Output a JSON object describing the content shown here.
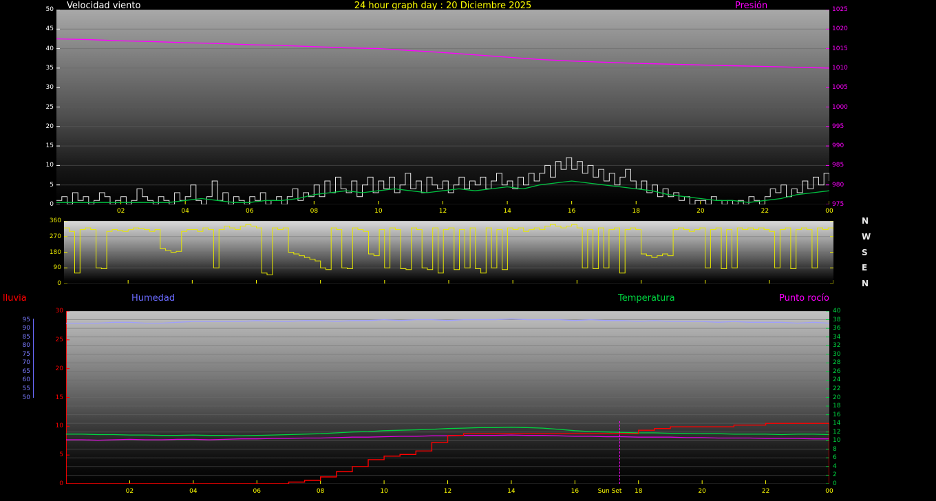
{
  "header": {
    "wind_speed": "Velocidad viento",
    "title": "24 hour graph day : 20 Diciembre 2025",
    "pressure": "Presión"
  },
  "bottom_labels": {
    "rain": "lluvia",
    "humidity": "Humedad",
    "temperature": "Temperatura",
    "dew_point": "Punto rocío"
  },
  "sun_set_label": "Sun Set",
  "x_ticks": [
    "02",
    "04",
    "06",
    "08",
    "10",
    "12",
    "14",
    "16",
    "18",
    "20",
    "22",
    "00"
  ],
  "compass": [
    "N",
    "W",
    "S",
    "E",
    "N"
  ],
  "colors": {
    "title": "#ffff00",
    "wind": "#e8e8e8",
    "wind_avg": "#00c040",
    "pressure": "#ff00ff",
    "direction": "#e8e800",
    "rain": "#ff0000",
    "humidity": "#7b7bff",
    "temperature": "#00d540",
    "dew_point": "#e000e0",
    "x_ticks": "#ffff00"
  },
  "axes": {
    "wind": {
      "min": 0,
      "max": 50,
      "ticks": [
        50,
        45,
        40,
        35,
        30,
        25,
        20,
        15,
        10,
        5,
        0
      ],
      "color": "#ffffff"
    },
    "pressure": {
      "min": 975,
      "max": 1025,
      "ticks": [
        1025,
        1020,
        1015,
        1010,
        1005,
        1000,
        995,
        990,
        985,
        980,
        975
      ],
      "color": "#ff00ff"
    },
    "direction": {
      "min": 0,
      "max": 360,
      "ticks": [
        360,
        270,
        180,
        90,
        0
      ],
      "color": "#e8e800"
    },
    "humidity": {
      "min": 0,
      "max": 100,
      "ticks": [
        95,
        90,
        85,
        80,
        75,
        70,
        65,
        60,
        55,
        50
      ],
      "color": "#7b7bff"
    },
    "rain": {
      "min": 0,
      "max": 30,
      "ticks": [
        30,
        25,
        20,
        15,
        10,
        5,
        0
      ],
      "color": "#ff0000"
    },
    "temperature": {
      "min": 0,
      "max": 40,
      "ticks": [
        40,
        38,
        36,
        34,
        32,
        30,
        28,
        26,
        24,
        22,
        20,
        18,
        16,
        14,
        12,
        10,
        8,
        6,
        4,
        2,
        0
      ],
      "color": "#00d540"
    }
  },
  "chart_data": [
    {
      "type": "line",
      "title": "Velocidad viento / Presión",
      "x_range": [
        0,
        24
      ],
      "grid_axis": "wind",
      "grid_color": "#636363",
      "x_tick_color": "#ffff00",
      "edge_ticks": [
        {
          "axis": "wind",
          "side": "left",
          "color": "#ffffff"
        },
        {
          "axis": "pressure",
          "side": "right",
          "color": "#ff00ff"
        }
      ],
      "series": [
        {
          "name": "pressure-hpa",
          "color": "#ff00ff",
          "axis": "pressure",
          "mode": "linear",
          "width": 1.4,
          "step_hours": 1,
          "values": [
            1017.5,
            1017.3,
            1017.0,
            1016.8,
            1016.5,
            1016.3,
            1016.0,
            1015.8,
            1015.5,
            1015.2,
            1015.0,
            1014.5,
            1014.0,
            1013.4,
            1012.8,
            1012.2,
            1011.8,
            1011.5,
            1011.2,
            1011.0,
            1010.8,
            1010.6,
            1010.4,
            1010.2,
            1010.0
          ]
        },
        {
          "name": "wind-gust",
          "color": "#e8e8e8",
          "axis": "wind",
          "mode": "step",
          "width": 1,
          "step_hours": 0.1666667,
          "values": [
            1,
            2,
            0,
            3,
            1,
            2,
            0,
            1,
            3,
            2,
            0,
            1,
            2,
            0,
            1,
            4,
            2,
            1,
            0,
            2,
            1,
            0,
            3,
            1,
            2,
            5,
            1,
            0,
            2,
            6,
            1,
            3,
            0,
            2,
            1,
            0,
            2,
            1,
            3,
            0,
            1,
            2,
            0,
            2,
            4,
            1,
            3,
            2,
            5,
            2,
            6,
            3,
            7,
            4,
            3,
            6,
            2,
            5,
            7,
            3,
            6,
            4,
            7,
            3,
            5,
            8,
            4,
            6,
            3,
            7,
            5,
            4,
            6,
            3,
            5,
            7,
            4,
            6,
            5,
            7,
            4,
            6,
            8,
            5,
            6,
            4,
            7,
            5,
            8,
            6,
            8,
            10,
            7,
            11,
            9,
            12,
            9,
            11,
            8,
            10,
            7,
            9,
            6,
            8,
            5,
            7,
            9,
            6,
            4,
            6,
            3,
            5,
            2,
            4,
            2,
            3,
            1,
            2,
            0,
            1,
            1,
            0,
            2,
            1,
            0,
            1,
            0,
            1,
            0,
            2,
            1,
            0,
            2,
            4,
            3,
            5,
            2,
            4,
            3,
            6,
            4,
            7,
            5,
            8,
            6
          ]
        },
        {
          "name": "wind-average",
          "color": "#00c040",
          "axis": "wind",
          "mode": "linear",
          "width": 1.3,
          "step_hours": 0.5,
          "values": [
            0.5,
            0.5,
            0.5,
            0.5,
            0.5,
            0.5,
            0.5,
            0.5,
            1,
            1.5,
            1,
            0.5,
            0.5,
            1,
            1,
            1.5,
            2.5,
            3,
            3.5,
            3,
            3.5,
            4,
            3.5,
            3,
            3.5,
            4,
            3.5,
            4,
            4.5,
            4,
            5,
            5.5,
            6,
            5.5,
            5,
            4.5,
            4,
            3.5,
            2.5,
            2,
            1.5,
            1,
            1,
            0.5,
            1,
            1.5,
            2.5,
            3,
            3.5
          ]
        }
      ]
    },
    {
      "type": "line",
      "title": "Dirección viento",
      "x_range": [
        0,
        24
      ],
      "grid_axis": "direction",
      "grid_color": "#6e6e6e",
      "x_tick_color": "#ffff00",
      "edge_ticks": [
        {
          "axis": "direction",
          "side": "left",
          "color": "#e8e800"
        },
        {
          "axis": "direction",
          "side": "right",
          "color": "#e8e800"
        }
      ],
      "series": [
        {
          "name": "wind-direction-deg",
          "color": "#e8e800",
          "axis": "direction",
          "mode": "step",
          "width": 1,
          "step_hours": 0.1666667,
          "values": [
            320,
            300,
            60,
            310,
            320,
            310,
            90,
            85,
            300,
            310,
            305,
            300,
            310,
            320,
            315,
            310,
            300,
            310,
            200,
            190,
            180,
            185,
            300,
            310,
            310,
            300,
            320,
            310,
            90,
            310,
            330,
            320,
            310,
            330,
            340,
            330,
            320,
            60,
            50,
            320,
            310,
            320,
            180,
            170,
            160,
            150,
            140,
            130,
            90,
            80,
            320,
            310,
            90,
            85,
            320,
            310,
            300,
            170,
            160,
            310,
            90,
            320,
            310,
            85,
            80,
            320,
            310,
            90,
            80,
            320,
            60,
            310,
            320,
            80,
            310,
            90,
            320,
            85,
            60,
            320,
            90,
            310,
            80,
            320,
            310,
            320,
            300,
            310,
            320,
            310,
            330,
            340,
            330,
            320,
            330,
            340,
            320,
            90,
            310,
            85,
            320,
            90,
            310,
            320,
            60,
            310,
            320,
            310,
            170,
            160,
            150,
            160,
            170,
            160,
            310,
            320,
            310,
            300,
            310,
            320,
            90,
            310,
            320,
            85,
            310,
            90,
            320,
            310,
            320,
            310,
            320,
            310,
            300,
            90,
            310,
            320,
            85,
            310,
            320,
            310,
            90,
            320,
            310,
            320,
            310
          ]
        }
      ]
    },
    {
      "type": "line",
      "title": "lluvia / Humedad / Temperatura / Punto rocío",
      "x_range": [
        0,
        24
      ],
      "grid_axis": "temperature",
      "grid_color": "#6a6a6a",
      "x_tick_color": "#ffff00",
      "axis_lines": [
        {
          "side": "left",
          "color": "#ff0000"
        }
      ],
      "edge_ticks": [
        {
          "axis": "rain",
          "side": "left",
          "color": "#ff0000"
        },
        {
          "axis": "temperature",
          "side": "right",
          "color": "#00d540"
        }
      ],
      "series": [
        {
          "name": "humidity-pct",
          "color": "#9f9fff",
          "axis": "humidity",
          "mode": "linear",
          "width": 1.3,
          "step_hours": 0.5,
          "values": [
            93,
            93,
            93,
            93.5,
            93.5,
            93,
            93,
            93.5,
            94,
            94,
            94,
            94,
            94.5,
            94,
            94,
            94.5,
            94.5,
            94,
            94.5,
            94.5,
            95,
            94.5,
            95,
            95,
            94.5,
            95,
            95,
            95,
            95.5,
            95,
            95,
            95,
            94.5,
            95,
            94.5,
            94.5,
            94,
            94.5,
            94,
            94,
            94,
            93.5,
            94,
            93.5,
            93.5,
            93.5,
            93,
            93.5,
            93
          ]
        },
        {
          "name": "dew-point-c",
          "color": "#e000e0",
          "axis": "temperature",
          "mode": "linear",
          "width": 1.3,
          "step_hours": 0.5,
          "values": [
            10.2,
            10.2,
            10.1,
            10.2,
            10.3,
            10.2,
            10.2,
            10.3,
            10.3,
            10.2,
            10.3,
            10.4,
            10.4,
            10.5,
            10.5,
            10.6,
            10.6,
            10.7,
            10.8,
            10.8,
            10.9,
            11.0,
            11.0,
            11.1,
            11.1,
            11.2,
            11.2,
            11.2,
            11.3,
            11.2,
            11.2,
            11.1,
            11.0,
            11.0,
            10.9,
            10.9,
            10.8,
            10.8,
            10.8,
            10.7,
            10.7,
            10.6,
            10.6,
            10.6,
            10.5,
            10.5,
            10.5,
            10.4,
            10.4
          ]
        },
        {
          "name": "temperature-c",
          "color": "#00d540",
          "axis": "temperature",
          "mode": "linear",
          "width": 1.3,
          "step_hours": 0.5,
          "values": [
            11.5,
            11.5,
            11.4,
            11.4,
            11.3,
            11.3,
            11.2,
            11.2,
            11.3,
            11.2,
            11.2,
            11.1,
            11.2,
            11.3,
            11.4,
            11.5,
            11.6,
            11.8,
            12.0,
            12.1,
            12.3,
            12.4,
            12.5,
            12.6,
            12.8,
            12.9,
            13.0,
            13.0,
            13.1,
            13.0,
            12.9,
            12.6,
            12.3,
            12.1,
            12.0,
            11.9,
            11.8,
            11.8,
            11.7,
            11.7,
            11.6,
            11.6,
            11.5,
            11.5,
            11.5,
            11.4,
            11.5,
            11.5,
            11.4
          ]
        },
        {
          "name": "rain-mm",
          "color": "#ff0000",
          "axis": "rain",
          "mode": "step",
          "width": 1.4,
          "step_hours": 0.5,
          "values": [
            0,
            0,
            0,
            0,
            0,
            0,
            0,
            0,
            0,
            0,
            0,
            0,
            0,
            0,
            0.3,
            0.6,
            1.2,
            2.1,
            3.0,
            4.2,
            4.8,
            5.1,
            5.7,
            7.2,
            8.4,
            8.7,
            8.7,
            8.7,
            8.7,
            8.7,
            8.7,
            8.7,
            8.7,
            8.7,
            8.7,
            8.7,
            9.3,
            9.6,
            9.9,
            9.9,
            9.9,
            9.9,
            10.2,
            10.2,
            10.5,
            10.5,
            10.5,
            10.5,
            0
          ]
        }
      ]
    }
  ]
}
